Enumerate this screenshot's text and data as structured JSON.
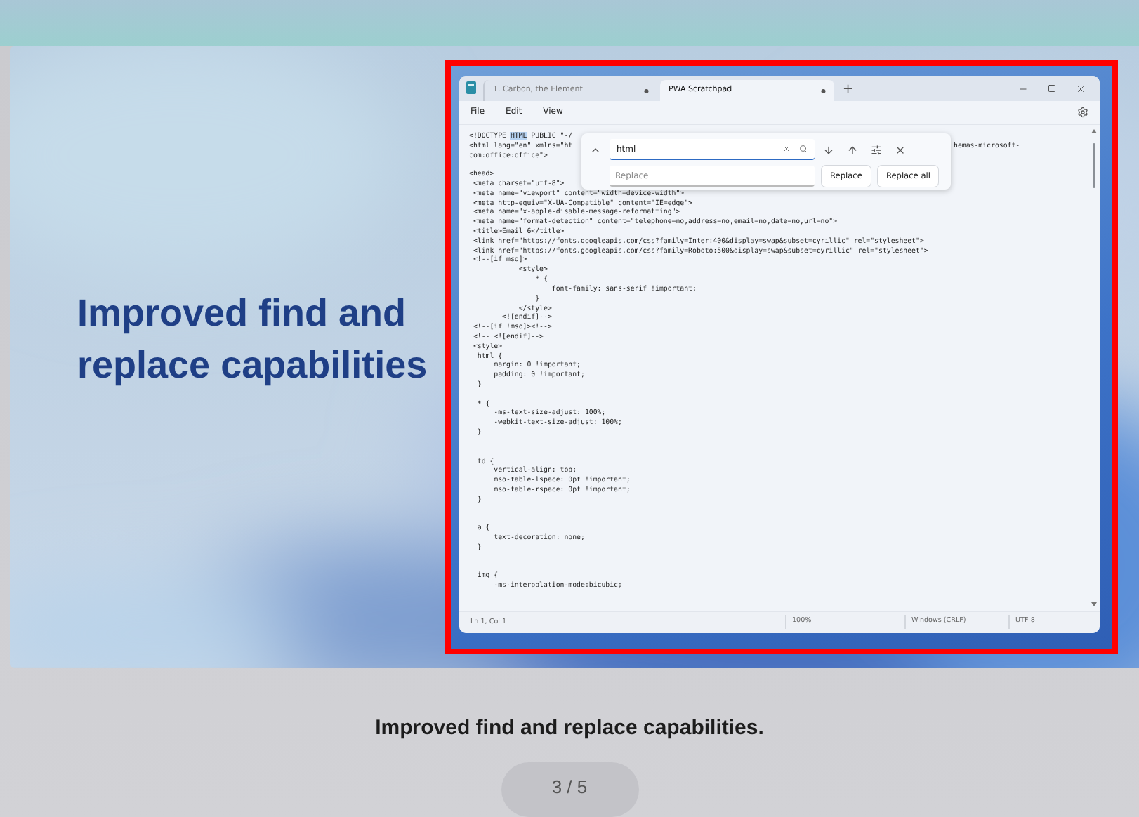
{
  "slide": {
    "heading": "Improved find and replace capabilities"
  },
  "app_window": {
    "tabs": [
      {
        "label": "1. Carbon, the Element",
        "dot": "●",
        "selected": false
      },
      {
        "label": "PWA Scratchpad",
        "dot": "●",
        "selected": true
      }
    ],
    "new_tab": "+",
    "menu": [
      "File",
      "Edit",
      "View"
    ],
    "find": {
      "value": "html",
      "replace_placeholder": "Replace",
      "buttons": [
        "Replace",
        "Replace all"
      ]
    },
    "code_blocks": [
      {
        "lines": [
          {
            "parts": [
              {
                "text": "<!DOCTYPE ",
                "kind": "plain"
              },
              {
                "text": "HTML",
                "kind": "match"
              },
              {
                "text": " PUBLIC \"-/",
                "kind": "plain"
              }
            ]
          },
          {
            "parts": [
              {
                "text": "<html lang=\"en\" xmlns=\"ht",
                "kind": "plain"
              },
              {
                "text": "hemas-microsoft-",
                "kind": "past-panel"
              }
            ]
          },
          "com:office:office\">"
        ]
      },
      {
        "kind": "spaced",
        "lines": [
          "<head>",
          " <meta charset=\"utf-8\">",
          " <meta name=\"viewport\" content=\"width=device-width\">",
          " <meta http-equiv=\"X-UA-Compatible\" content=\"IE=edge\">",
          " <meta name=\"x-apple-disable-message-reformatting\">",
          " <meta name=\"format-detection\" content=\"telephone=no,address=no,email=no,date=no,url=no\">",
          " <title>Email 6</title>",
          " <link href=\"https://fonts.googleapis.com/css?family=Inter:400&display=swap&subset=cyrillic\" rel=\"stylesheet\">",
          " <link href=\"https://fonts.googleapis.com/css?family=Roboto:500&display=swap&subset=cyrillic\" rel=\"stylesheet\">",
          " <!--[if mso]>",
          "            <style>",
          "                * {",
          "                    font-family: sans-serif !important;",
          "                }",
          "            </style>",
          "        <![endif]-->",
          " <!--[if !mso]><!-->",
          " <!-- <![endif]-->",
          " <style>",
          "  html {",
          "      margin: 0 !important;",
          "      padding: 0 !important;",
          "  }"
        ]
      },
      {
        "kind": "spaced",
        "lines": [
          "  * {",
          "      -ms-text-size-adjust: 100%;",
          "      -webkit-text-size-adjust: 100%;",
          "  }"
        ]
      },
      {
        "kind": "wide",
        "lines": [
          "  td {",
          "      vertical-align: top;",
          "      mso-table-lspace: 0pt !important;",
          "      mso-table-rspace: 0pt !important;",
          "  }"
        ]
      },
      {
        "kind": "wide",
        "lines": [
          "  a {",
          "      text-decoration: none;",
          "  }"
        ]
      },
      {
        "kind": "wide",
        "lines": [
          "  img {",
          "      -ms-interpolation-mode:bicubic;"
        ]
      }
    ],
    "status_bar": [
      "Ln 1, Col 1",
      "100%",
      "Windows (CRLF)",
      "UTF-8"
    ]
  },
  "caption": "Improved find and replace capabilities.",
  "pager": "3 / 5"
}
